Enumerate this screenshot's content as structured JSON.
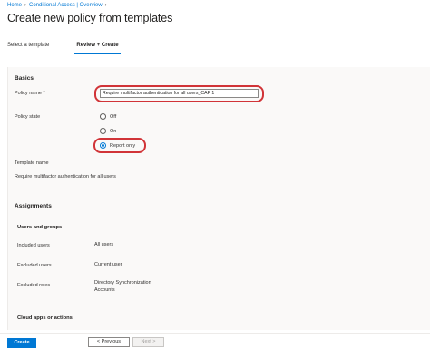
{
  "breadcrumb": {
    "items": [
      "Home",
      "Conditional Access | Overview"
    ]
  },
  "page": {
    "title": "Create new policy from templates",
    "more_label": "..."
  },
  "tabs": [
    {
      "label": "Select a template",
      "active": false
    },
    {
      "label": "Review + Create",
      "active": true
    }
  ],
  "basics": {
    "heading": "Basics",
    "policy_name_label": "Policy name",
    "required_marker": "*",
    "policy_name_value": "Require multifactor authentication for all users_CAP 1",
    "policy_state_label": "Policy state",
    "states": [
      "Off",
      "On",
      "Report only"
    ],
    "selected_state": "Report only",
    "template_name_label": "Template name",
    "template_name_value": "Require multifactor authentication for all users"
  },
  "assignments": {
    "heading": "Assignments",
    "users_groups_heading": "Users and groups",
    "rows": [
      {
        "label": "Included users",
        "value": "All users"
      },
      {
        "label": "Excluded users",
        "value": "Current user"
      },
      {
        "label": "Excluded roles",
        "value": "Directory Synchronization Accounts"
      }
    ],
    "cloud_apps_heading": "Cloud apps or actions"
  },
  "footer": {
    "create_label": "Create",
    "previous_label": "< Previous",
    "next_label": "Next >"
  },
  "colors": {
    "accent": "#0078d4",
    "highlight": "#d13438"
  }
}
